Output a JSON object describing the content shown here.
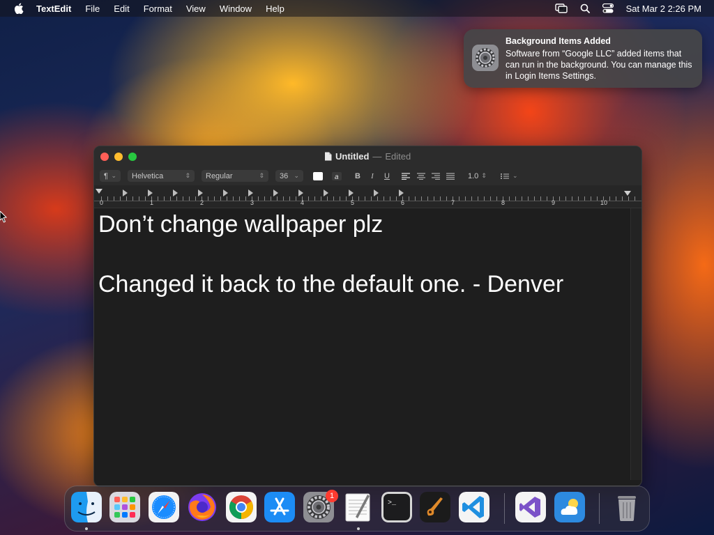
{
  "menubar": {
    "app_name": "TextEdit",
    "menus": [
      "File",
      "Edit",
      "Format",
      "View",
      "Window",
      "Help"
    ],
    "clock": "Sat Mar 2  2:26 PM"
  },
  "notification": {
    "title": "Background Items Added",
    "body": "Software from “Google LLC” added items that can run in the background. You can manage this in Login Items Settings."
  },
  "window": {
    "title": "Untitled",
    "separator": "—",
    "status": "Edited",
    "toolbar": {
      "paragraph": "¶",
      "font_family": "Helvetica",
      "font_style": "Regular",
      "font_size": "36",
      "bold": "B",
      "italic": "I",
      "underline": "U",
      "line_spacing": "1.0"
    },
    "ruler_numbers": [
      "0",
      "1",
      "2",
      "3",
      "4",
      "5",
      "6",
      "7",
      "8",
      "9",
      "10"
    ],
    "document_lines": [
      "Don’t change wallpaper plz",
      "Changed it back to the default one. - Denver"
    ]
  },
  "dock": {
    "system_settings_badge": "1",
    "apps": [
      "finder-icon",
      "launchpad-icon",
      "safari-icon",
      "firefox-icon",
      "chrome-icon",
      "app-store-icon",
      "system-settings-icon",
      "textedit-icon",
      "terminal-icon",
      "garageband-icon",
      "vscode-icon",
      "visual-studio-icon",
      "weather-icon",
      "trash-icon"
    ]
  },
  "colors": {
    "close": "#ff5f57",
    "minimize": "#febc2e",
    "zoom": "#28c840",
    "badge": "#ff3b30"
  }
}
